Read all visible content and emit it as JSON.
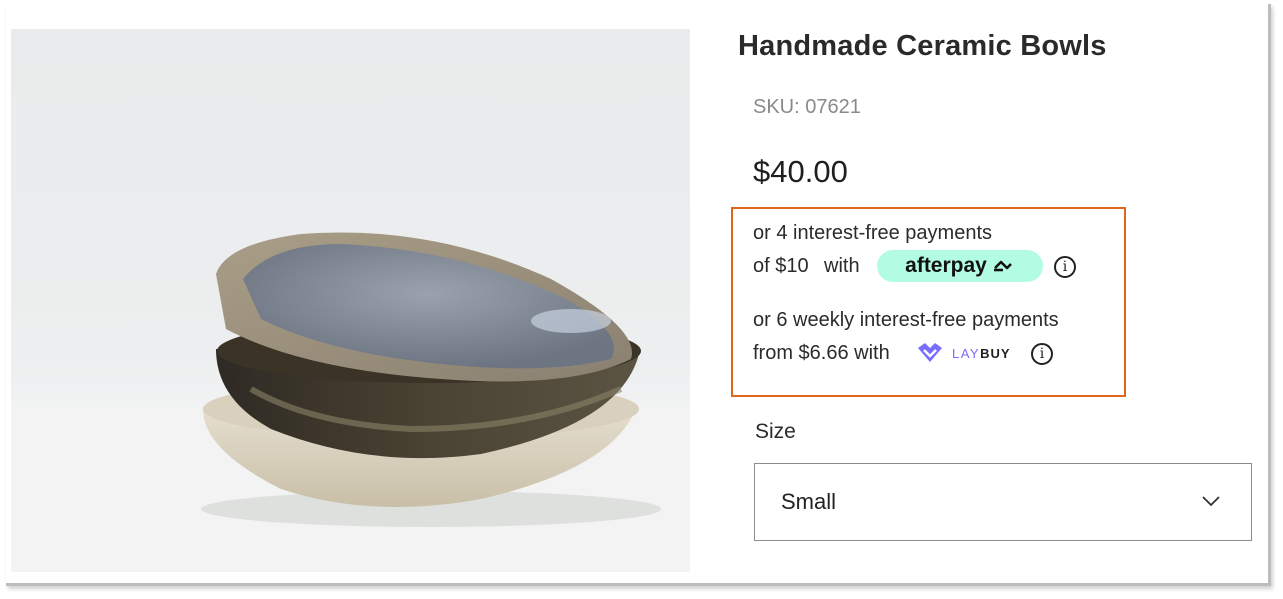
{
  "product": {
    "title": "Handmade Ceramic Bowls",
    "sku": "SKU: 07621",
    "price": "$40.00"
  },
  "payments": {
    "afterpay": {
      "line1": "or 4 interest-free payments",
      "line2_prefix": "of $10",
      "line2_with": "with",
      "badge": "afterpay",
      "badge_color": "#b2fce4",
      "info_glyph": "i"
    },
    "laybuy": {
      "line1": "or 6 weekly interest-free payments",
      "line2": "from $6.66 with",
      "logo_lay": "LAY",
      "logo_buy": "BUY",
      "brand_color": "#786dff",
      "info_glyph": "i"
    }
  },
  "options": {
    "size_label": "Size",
    "size_value": "Small"
  },
  "icons": [
    "afterpay-arrows-icon",
    "info-icon",
    "laybuy-heart-icon",
    "chevron-down-icon"
  ],
  "colors": {
    "highlight_box": "#e0661c"
  }
}
